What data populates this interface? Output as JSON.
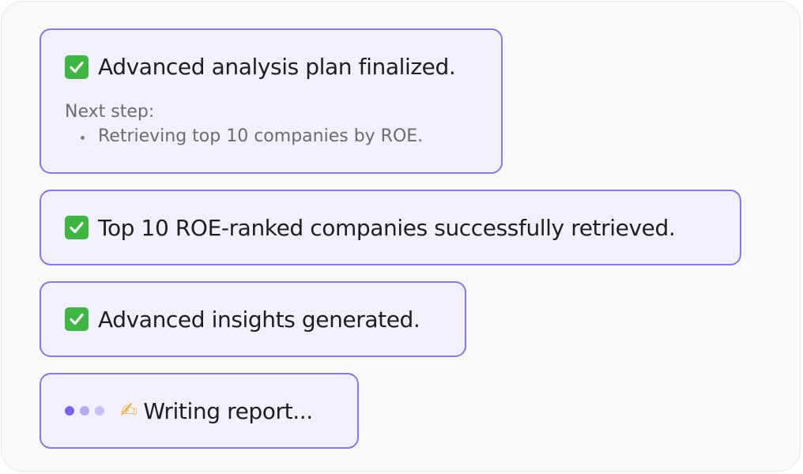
{
  "steps": [
    {
      "status": "done",
      "icon": "check-icon",
      "text": "Advanced analysis plan finalized.",
      "next_step_label": "Next step:",
      "next_items": [
        "Retrieving top 10 companies by ROE."
      ]
    },
    {
      "status": "done",
      "icon": "check-icon",
      "text": "Top 10 ROE-ranked companies successfully retrieved."
    },
    {
      "status": "done",
      "icon": "check-icon",
      "text": "Advanced insights generated."
    },
    {
      "status": "in-progress",
      "icon": "writing-hand-icon",
      "text": "Writing report..."
    }
  ],
  "colors": {
    "card_background": "#f1f0fd",
    "card_border": "#8b75ea",
    "check_green": "#3fb542",
    "loading_dot_primary": "#7d63ec",
    "loading_dot_secondary": "#b7a9f4"
  }
}
